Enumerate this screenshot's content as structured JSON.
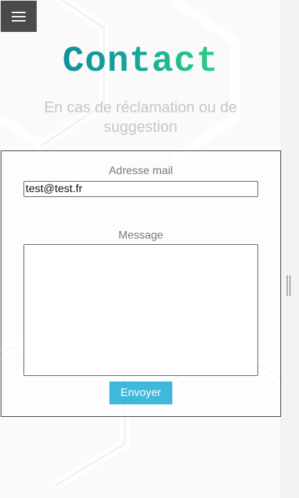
{
  "nav": {
    "menu_icon": "hamburger-menu-icon"
  },
  "header": {
    "title": "Contact",
    "subtitle": "En cas de réclamation ou de suggestion"
  },
  "form": {
    "email_label": "Adresse mail",
    "email_value": "test@test.fr",
    "message_label": "Message",
    "message_value": "",
    "submit_label": "Envoyer"
  },
  "colors": {
    "title_gradient_start": "#10909a",
    "title_gradient_end": "#2fcf86",
    "button": "#3db9dc",
    "menu_button": "#4a4a4a",
    "subtitle": "#c6c6c6"
  }
}
